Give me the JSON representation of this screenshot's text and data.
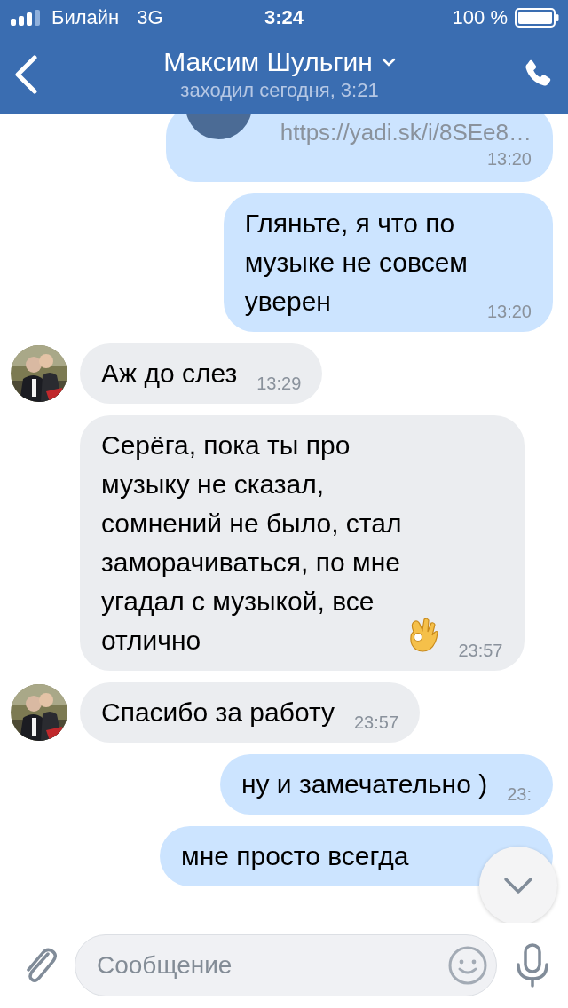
{
  "status_bar": {
    "carrier": "Билайн",
    "network": "3G",
    "time": "3:24",
    "battery": "100 %"
  },
  "header": {
    "title": "Максим Шульгин",
    "subtitle": "заходил сегодня, 3:21"
  },
  "messages": [
    {
      "outgoing": true,
      "kind": "link",
      "link": "https://yadi.sk/i/8SEe8…",
      "time": "13:20"
    },
    {
      "outgoing": true,
      "kind": "text",
      "text": "Гляньте, я что по\nмузыке не совсем\nуверен",
      "time": "13:20"
    },
    {
      "outgoing": false,
      "kind": "text",
      "avatar": true,
      "text": "Аж до слез",
      "time": "13:29"
    },
    {
      "outgoing": false,
      "kind": "emoji_text",
      "avatar": false,
      "text": "Серёга, пока ты про\nмузыку не сказал,\nсомнений не было, стал\nзаморачиваться, по мне\nугадал с музыкой, все\nотлично",
      "time": "23:57"
    },
    {
      "outgoing": false,
      "kind": "text",
      "avatar": true,
      "text": "Спасибо за работу",
      "time": "23:57"
    },
    {
      "outgoing": true,
      "kind": "text",
      "text": "ну и замечательно )",
      "time": "23:"
    },
    {
      "outgoing": true,
      "kind": "text",
      "text": "мне просто всегда"
    }
  ],
  "composer": {
    "placeholder": "Сообщение"
  }
}
